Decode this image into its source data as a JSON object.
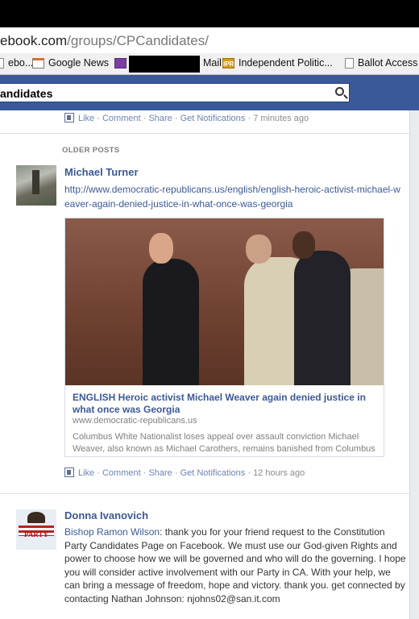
{
  "browser": {
    "url_host": "ebook.com",
    "url_path": "/groups/CPCandidates/",
    "bookmarks": [
      {
        "label": "ebo...",
        "icon": "page-icon"
      },
      {
        "label": "Google News",
        "icon": "news-icon"
      },
      {
        "label": "Mail",
        "icon": "mail-icon"
      },
      {
        "label": "Independent Politic...",
        "icon": "ipr-icon",
        "icon_text": "IPR"
      },
      {
        "label": "Ballot Access",
        "icon": "page-icon"
      }
    ]
  },
  "search": {
    "value": "andidates"
  },
  "post_top": {
    "actions": {
      "like": "Like",
      "comment": "Comment",
      "share": "Share",
      "notify": "Get Notifications",
      "time": "7 minutes ago"
    }
  },
  "older_posts_label": "OLDER POSTS",
  "post1": {
    "author": "Michael Turner",
    "link": "http://www.democratic-republicans.us/english/english-heroic-activist-michael-weaver-again-denied-justice-in-what-once-was-georgia",
    "attachment": {
      "title": "ENGLISH Heroic activist Michael Weaver again denied justice in what once was Georgia",
      "domain": "www.democratic-republicans.us",
      "description": "Columbus White Nationalist loses appeal over assault conviction Michael Weaver, also known as Michael Carothers, remains banished from Columbus"
    },
    "actions": {
      "like": "Like",
      "comment": "Comment",
      "share": "Share",
      "notify": "Get Notifications",
      "time": "12 hours ago"
    }
  },
  "post2": {
    "author": "Donna Ivanovich",
    "avatar_text": "PARTY",
    "mention": "Bishop Ramon Wilson",
    "message": ": thank you for your friend request to the Constitution Party Candidates Page on Facebook. We must use our God-given Rights and power to choose how we will be governed and who will do the governing. I hope you will consider active involvement with our Party in CA. With your help, we can bring a message of freedom, hope and victory. thank you. get connected by contacting Nathan Johnson: njohns02@san.it.com"
  },
  "colors": {
    "facebook_blue": "#3b5998",
    "link_blue": "#3b5998",
    "meta_gray": "#8c8c8c"
  }
}
